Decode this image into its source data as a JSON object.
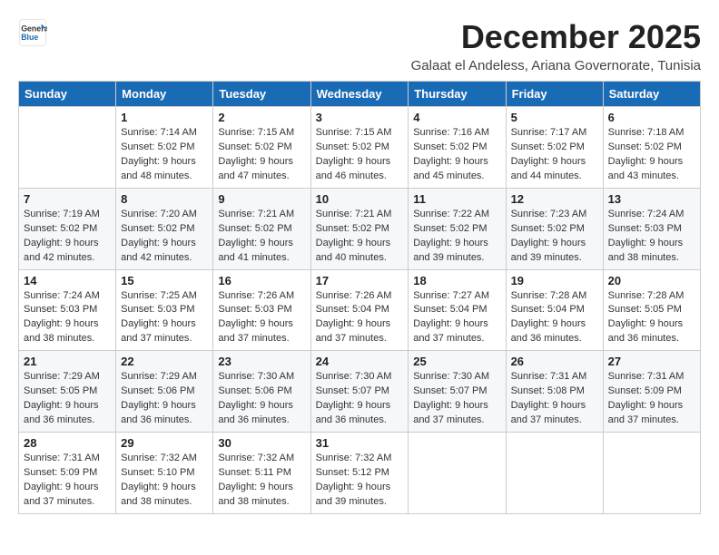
{
  "logo": {
    "line1": "General",
    "line2": "Blue"
  },
  "title": "December 2025",
  "subtitle": "Galaat el Andeless, Ariana Governorate, Tunisia",
  "header_days": [
    "Sunday",
    "Monday",
    "Tuesday",
    "Wednesday",
    "Thursday",
    "Friday",
    "Saturday"
  ],
  "weeks": [
    [
      {
        "day": "",
        "sunrise": "",
        "sunset": "",
        "daylight": ""
      },
      {
        "day": "1",
        "sunrise": "Sunrise: 7:14 AM",
        "sunset": "Sunset: 5:02 PM",
        "daylight": "Daylight: 9 hours and 48 minutes."
      },
      {
        "day": "2",
        "sunrise": "Sunrise: 7:15 AM",
        "sunset": "Sunset: 5:02 PM",
        "daylight": "Daylight: 9 hours and 47 minutes."
      },
      {
        "day": "3",
        "sunrise": "Sunrise: 7:15 AM",
        "sunset": "Sunset: 5:02 PM",
        "daylight": "Daylight: 9 hours and 46 minutes."
      },
      {
        "day": "4",
        "sunrise": "Sunrise: 7:16 AM",
        "sunset": "Sunset: 5:02 PM",
        "daylight": "Daylight: 9 hours and 45 minutes."
      },
      {
        "day": "5",
        "sunrise": "Sunrise: 7:17 AM",
        "sunset": "Sunset: 5:02 PM",
        "daylight": "Daylight: 9 hours and 44 minutes."
      },
      {
        "day": "6",
        "sunrise": "Sunrise: 7:18 AM",
        "sunset": "Sunset: 5:02 PM",
        "daylight": "Daylight: 9 hours and 43 minutes."
      }
    ],
    [
      {
        "day": "7",
        "sunrise": "Sunrise: 7:19 AM",
        "sunset": "Sunset: 5:02 PM",
        "daylight": "Daylight: 9 hours and 42 minutes."
      },
      {
        "day": "8",
        "sunrise": "Sunrise: 7:20 AM",
        "sunset": "Sunset: 5:02 PM",
        "daylight": "Daylight: 9 hours and 42 minutes."
      },
      {
        "day": "9",
        "sunrise": "Sunrise: 7:21 AM",
        "sunset": "Sunset: 5:02 PM",
        "daylight": "Daylight: 9 hours and 41 minutes."
      },
      {
        "day": "10",
        "sunrise": "Sunrise: 7:21 AM",
        "sunset": "Sunset: 5:02 PM",
        "daylight": "Daylight: 9 hours and 40 minutes."
      },
      {
        "day": "11",
        "sunrise": "Sunrise: 7:22 AM",
        "sunset": "Sunset: 5:02 PM",
        "daylight": "Daylight: 9 hours and 39 minutes."
      },
      {
        "day": "12",
        "sunrise": "Sunrise: 7:23 AM",
        "sunset": "Sunset: 5:02 PM",
        "daylight": "Daylight: 9 hours and 39 minutes."
      },
      {
        "day": "13",
        "sunrise": "Sunrise: 7:24 AM",
        "sunset": "Sunset: 5:03 PM",
        "daylight": "Daylight: 9 hours and 38 minutes."
      }
    ],
    [
      {
        "day": "14",
        "sunrise": "Sunrise: 7:24 AM",
        "sunset": "Sunset: 5:03 PM",
        "daylight": "Daylight: 9 hours and 38 minutes."
      },
      {
        "day": "15",
        "sunrise": "Sunrise: 7:25 AM",
        "sunset": "Sunset: 5:03 PM",
        "daylight": "Daylight: 9 hours and 37 minutes."
      },
      {
        "day": "16",
        "sunrise": "Sunrise: 7:26 AM",
        "sunset": "Sunset: 5:03 PM",
        "daylight": "Daylight: 9 hours and 37 minutes."
      },
      {
        "day": "17",
        "sunrise": "Sunrise: 7:26 AM",
        "sunset": "Sunset: 5:04 PM",
        "daylight": "Daylight: 9 hours and 37 minutes."
      },
      {
        "day": "18",
        "sunrise": "Sunrise: 7:27 AM",
        "sunset": "Sunset: 5:04 PM",
        "daylight": "Daylight: 9 hours and 37 minutes."
      },
      {
        "day": "19",
        "sunrise": "Sunrise: 7:28 AM",
        "sunset": "Sunset: 5:04 PM",
        "daylight": "Daylight: 9 hours and 36 minutes."
      },
      {
        "day": "20",
        "sunrise": "Sunrise: 7:28 AM",
        "sunset": "Sunset: 5:05 PM",
        "daylight": "Daylight: 9 hours and 36 minutes."
      }
    ],
    [
      {
        "day": "21",
        "sunrise": "Sunrise: 7:29 AM",
        "sunset": "Sunset: 5:05 PM",
        "daylight": "Daylight: 9 hours and 36 minutes."
      },
      {
        "day": "22",
        "sunrise": "Sunrise: 7:29 AM",
        "sunset": "Sunset: 5:06 PM",
        "daylight": "Daylight: 9 hours and 36 minutes."
      },
      {
        "day": "23",
        "sunrise": "Sunrise: 7:30 AM",
        "sunset": "Sunset: 5:06 PM",
        "daylight": "Daylight: 9 hours and 36 minutes."
      },
      {
        "day": "24",
        "sunrise": "Sunrise: 7:30 AM",
        "sunset": "Sunset: 5:07 PM",
        "daylight": "Daylight: 9 hours and 36 minutes."
      },
      {
        "day": "25",
        "sunrise": "Sunrise: 7:30 AM",
        "sunset": "Sunset: 5:07 PM",
        "daylight": "Daylight: 9 hours and 37 minutes."
      },
      {
        "day": "26",
        "sunrise": "Sunrise: 7:31 AM",
        "sunset": "Sunset: 5:08 PM",
        "daylight": "Daylight: 9 hours and 37 minutes."
      },
      {
        "day": "27",
        "sunrise": "Sunrise: 7:31 AM",
        "sunset": "Sunset: 5:09 PM",
        "daylight": "Daylight: 9 hours and 37 minutes."
      }
    ],
    [
      {
        "day": "28",
        "sunrise": "Sunrise: 7:31 AM",
        "sunset": "Sunset: 5:09 PM",
        "daylight": "Daylight: 9 hours and 37 minutes."
      },
      {
        "day": "29",
        "sunrise": "Sunrise: 7:32 AM",
        "sunset": "Sunset: 5:10 PM",
        "daylight": "Daylight: 9 hours and 38 minutes."
      },
      {
        "day": "30",
        "sunrise": "Sunrise: 7:32 AM",
        "sunset": "Sunset: 5:11 PM",
        "daylight": "Daylight: 9 hours and 38 minutes."
      },
      {
        "day": "31",
        "sunrise": "Sunrise: 7:32 AM",
        "sunset": "Sunset: 5:12 PM",
        "daylight": "Daylight: 9 hours and 39 minutes."
      },
      {
        "day": "",
        "sunrise": "",
        "sunset": "",
        "daylight": ""
      },
      {
        "day": "",
        "sunrise": "",
        "sunset": "",
        "daylight": ""
      },
      {
        "day": "",
        "sunrise": "",
        "sunset": "",
        "daylight": ""
      }
    ]
  ]
}
